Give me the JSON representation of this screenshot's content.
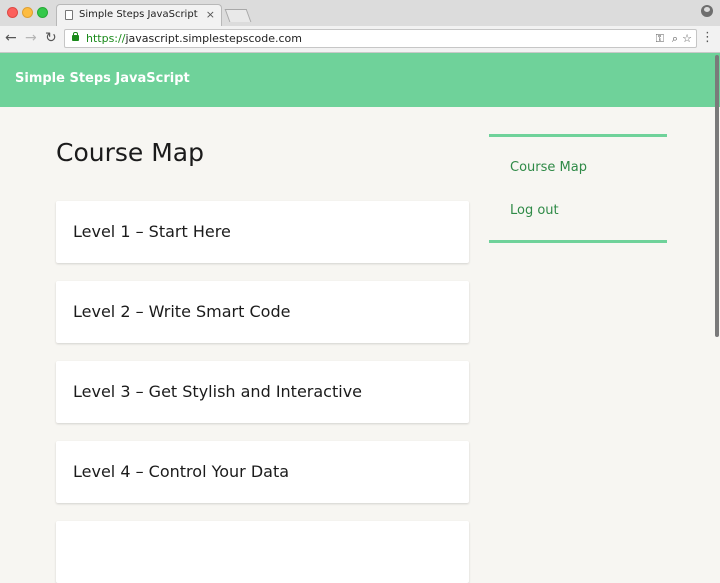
{
  "browser": {
    "tab_title": "Simple Steps JavaScript",
    "tab_close": "×",
    "back": "←",
    "forward": "→",
    "reload": "↻",
    "url_scheme": "https://",
    "url_host": "javascript.simplestepscode.com",
    "key_icon": "⚿",
    "zoom_icon": "⌕",
    "star_icon": "☆",
    "menu_icon": "⋮"
  },
  "site": {
    "title": "Simple Steps JavaScript"
  },
  "main": {
    "page_title": "Course Map",
    "levels": [
      {
        "label": "Level 1 – Start Here"
      },
      {
        "label": "Level 2 – Write Smart Code"
      },
      {
        "label": "Level 3 – Get Stylish and Interactive"
      },
      {
        "label": "Level 4 – Control Your Data"
      },
      {
        "label": ""
      }
    ]
  },
  "sidebar": {
    "links": [
      {
        "label": "Course Map"
      },
      {
        "label": "Log out"
      }
    ]
  },
  "colors": {
    "brand": "#6fd29a",
    "link": "#2f8a47",
    "background": "#f7f6f2"
  }
}
